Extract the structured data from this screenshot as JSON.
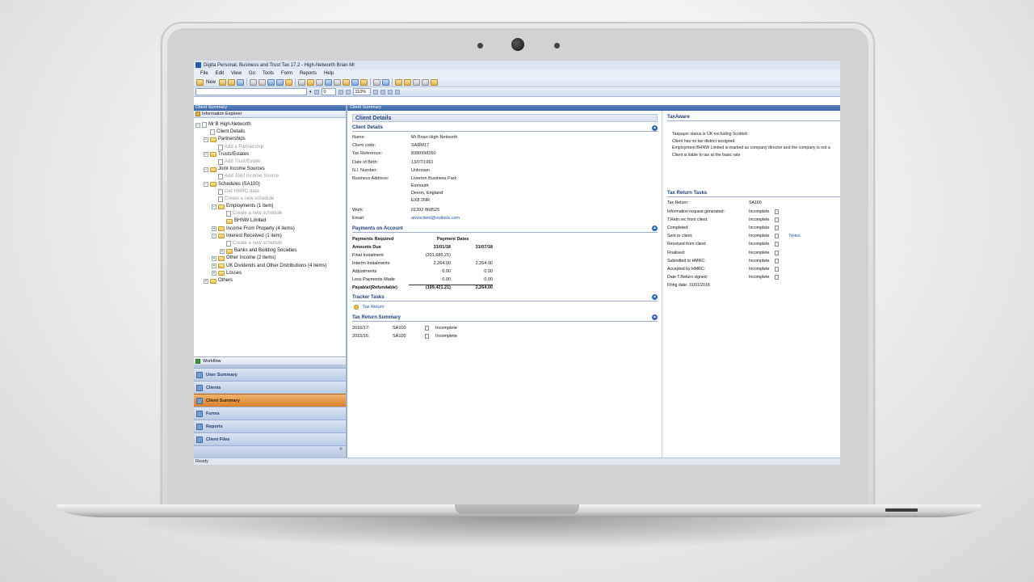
{
  "window": {
    "title": "Digita Personal, Business and Trust Tax 17.2 - High-Networth Brian Mr",
    "status": "Ready"
  },
  "menu": [
    "File",
    "Edit",
    "View",
    "Go",
    "Tools",
    "Form",
    "Reports",
    "Help"
  ],
  "toolbar": {
    "new_label": "New",
    "page_value": "0",
    "zoom_value": "110%"
  },
  "left_pane": {
    "header": "Client Summary",
    "explorer_title": "Information Explorer",
    "tree": [
      {
        "label": "Mr B High-Networth",
        "level": 0,
        "exp": "-",
        "icon": "doc",
        "dim": false
      },
      {
        "label": "Client Details",
        "level": 1,
        "exp": "",
        "icon": "doc",
        "dim": false
      },
      {
        "label": "Partnerships",
        "level": 1,
        "exp": "-",
        "icon": "fold",
        "dim": false
      },
      {
        "label": "Add a Partnership",
        "level": 2,
        "exp": "",
        "icon": "doc",
        "dim": true
      },
      {
        "label": "Trusts/Estates",
        "level": 1,
        "exp": "-",
        "icon": "fold",
        "dim": false
      },
      {
        "label": "Add Trust/Estate",
        "level": 2,
        "exp": "",
        "icon": "doc",
        "dim": true
      },
      {
        "label": "Joint Income Sources",
        "level": 1,
        "exp": "-",
        "icon": "fold",
        "dim": false
      },
      {
        "label": "Add Joint Income Source",
        "level": 2,
        "exp": "",
        "icon": "doc",
        "dim": true
      },
      {
        "label": "Schedules (SA100)",
        "level": 1,
        "exp": "-",
        "icon": "fold",
        "dim": false
      },
      {
        "label": "Get HMRC data",
        "level": 2,
        "exp": "",
        "icon": "doc",
        "dim": true
      },
      {
        "label": "Create a new schedule",
        "level": 2,
        "exp": "",
        "icon": "doc",
        "dim": true
      },
      {
        "label": "Employments (1 item)",
        "level": 2,
        "exp": "-",
        "icon": "fold",
        "dim": false
      },
      {
        "label": "Create a new schedule",
        "level": 3,
        "exp": "",
        "icon": "doc",
        "dim": true
      },
      {
        "label": "BHNW Limited",
        "level": 3,
        "exp": "",
        "icon": "fold",
        "dim": false
      },
      {
        "label": "Income From Property (4 items)",
        "level": 2,
        "exp": "+",
        "icon": "fold",
        "dim": false
      },
      {
        "label": "Interest Received (1 item)",
        "level": 2,
        "exp": "-",
        "icon": "fold",
        "dim": false
      },
      {
        "label": "Create a new schedule",
        "level": 3,
        "exp": "",
        "icon": "doc",
        "dim": true
      },
      {
        "label": "Banks and Building Societies",
        "level": 3,
        "exp": "+",
        "icon": "fold",
        "dim": false
      },
      {
        "label": "Other Income (2 items)",
        "level": 2,
        "exp": "+",
        "icon": "fold",
        "dim": false
      },
      {
        "label": "UK Dividends and Other Distributions (4 items)",
        "level": 2,
        "exp": "+",
        "icon": "fold",
        "dim": false
      },
      {
        "label": "Losses",
        "level": 2,
        "exp": "+",
        "icon": "fold",
        "dim": false
      },
      {
        "label": "Others",
        "level": 1,
        "exp": "+",
        "icon": "fold",
        "dim": false
      }
    ],
    "workflow_label": "Workflow",
    "nav": [
      {
        "label": "User Summary",
        "active": false
      },
      {
        "label": "Clients",
        "active": false
      },
      {
        "label": "Client Summary",
        "active": true
      },
      {
        "label": "Forms",
        "active": false
      },
      {
        "label": "Reports",
        "active": false
      },
      {
        "label": "Client Files",
        "active": false
      }
    ]
  },
  "content": {
    "header": "Client Summary",
    "panel_title": "Client Details",
    "client_details": {
      "title": "Client Details",
      "fields": [
        {
          "k": "Name:",
          "v": "Mr Brian High-Networth"
        },
        {
          "k": "Client code:",
          "v": "SARM17"
        },
        {
          "k": "Tax Reference:",
          "v": "8380998260"
        },
        {
          "k": "Date of Birth:",
          "v": "13/07/1991"
        },
        {
          "k": "N.I. Number:",
          "v": "Unknown"
        }
      ],
      "address_label": "Business Address:",
      "address": [
        "Liverton Business Park",
        "Exmouth",
        "Devon, England",
        "EX8 2NR"
      ],
      "work_label": "Work:",
      "work": "01392 868525",
      "email_label": "Email:",
      "email": "anvoclient@outlook.com"
    },
    "payments": {
      "title": "Payments on Account",
      "required_label": "Payments Required",
      "dates_label": "Payment Dates",
      "amounts_due_label": "Amounts Due",
      "date1": "31/01/18",
      "date2": "31/07/18",
      "rows": [
        {
          "label": "Final Instalment",
          "a": "(201,685.21)",
          "b": ""
        },
        {
          "label": "Interim Instalments",
          "a": "2,264.00",
          "b": "2,264.00"
        },
        {
          "label": "Adjustments",
          "a": "0.00",
          "b": "0.00"
        },
        {
          "label": "Less Payments Made",
          "a": "0.00",
          "b": "0.00"
        }
      ],
      "total_label": "Payable/(Refundable)",
      "total_a": "(199,421.21)",
      "total_b": "2,264.00"
    },
    "tracker": {
      "title": "Tracker Tasks",
      "item": "Tax Return"
    },
    "tax_return_summary": {
      "title": "Tax Return Summary",
      "rows": [
        {
          "year": "2016/17:",
          "ret": "SA100",
          "status": "Incomplete"
        },
        {
          "year": "2015/16:",
          "ret": "SA100",
          "status": "Incomplete"
        }
      ]
    },
    "taxaware": {
      "title": "TaxAware",
      "lines": [
        "Taxpayer status is UK excluding Scottish",
        "Client has no tax district assigned",
        "Employment BHNW Limited is marked as company director and the company is not a",
        "Client is liable to tax at the basic rate"
      ]
    },
    "tax_return_tasks": {
      "title": "Tax Return Tasks",
      "return_label": "Tax Return:",
      "return_value": "SA100",
      "rows": [
        {
          "k": "Information request generated:",
          "v": "Incomplete",
          "note": ""
        },
        {
          "k": "T.Retn rec from client:",
          "v": "Incomplete",
          "note": ""
        },
        {
          "k": "Completed:",
          "v": "Incomplete",
          "note": ""
        },
        {
          "k": "Sent to client:",
          "v": "Incomplete",
          "note": "Notes"
        },
        {
          "k": "Received from client:",
          "v": "Incomplete",
          "note": ""
        },
        {
          "k": "Finalised:",
          "v": "Incomplete",
          "note": ""
        },
        {
          "k": "Submitted to HMRC:",
          "v": "Incomplete",
          "note": ""
        },
        {
          "k": "Accepted by HMRC:",
          "v": "Incomplete",
          "note": ""
        },
        {
          "k": "Date T.Return signed:",
          "v": "Incomplete",
          "note": ""
        }
      ],
      "filing_date": "Filing date: 31/01/2018"
    }
  }
}
